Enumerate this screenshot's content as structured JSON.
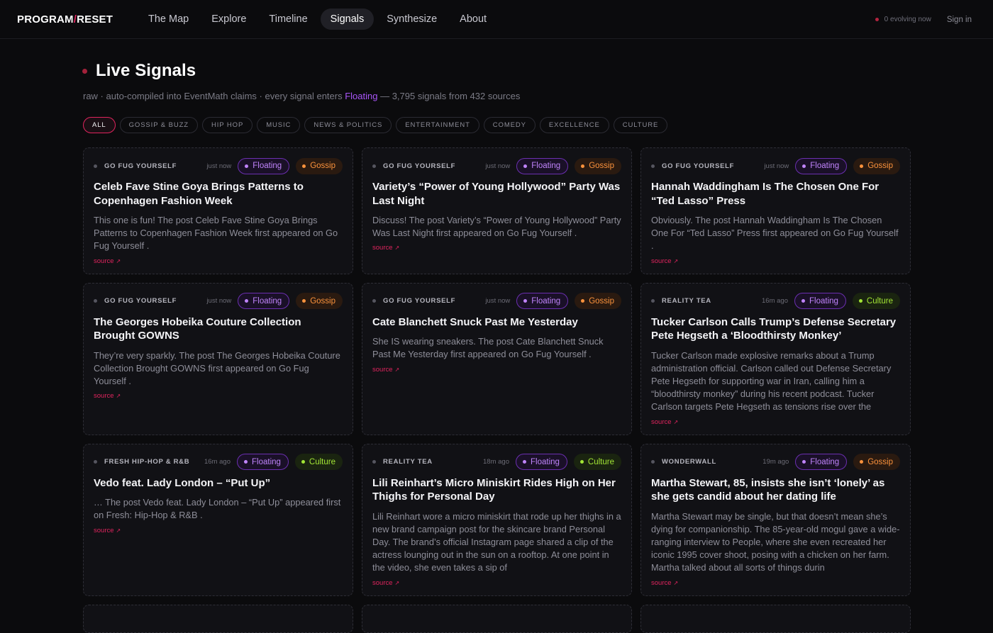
{
  "app": {
    "logo_left": "PROGRAM",
    "logo_slash": "/",
    "logo_right": "RESET"
  },
  "nav": [
    {
      "label": "The Map",
      "active": false
    },
    {
      "label": "Explore",
      "active": false
    },
    {
      "label": "Timeline",
      "active": false
    },
    {
      "label": "Signals",
      "active": true
    },
    {
      "label": "Synthesize",
      "active": false
    },
    {
      "label": "About",
      "active": false
    }
  ],
  "header": {
    "evolving": "0 evolving now",
    "signin": "Sign in"
  },
  "page": {
    "title": "Live Signals",
    "sub_pre": "raw · auto-compiled into EventMath claims · every signal enters ",
    "sub_hl": "Floating",
    "sub_post": " — 3,795 signals from 432 sources"
  },
  "filters": [
    "ALL",
    "GOSSIP & BUZZ",
    "HIP HOP",
    "MUSIC",
    "NEWS & POLITICS",
    "ENTERTAINMENT",
    "COMEDY",
    "EXCELLENCE",
    "CULTURE"
  ],
  "colors": {
    "accent": "#e0245e",
    "floating": "#c084fc",
    "gossip": "#fb923c",
    "culture": "#a3e635"
  },
  "cards": [
    {
      "source": "GO FUG YOURSELF",
      "time": "just now",
      "status": "Floating",
      "category": "Gossip",
      "title": "Celeb Fave Stine Goya Brings Patterns to Copenhagen Fashion Week",
      "desc": "This one is fun! The post Celeb Fave Stine Goya Brings Patterns to Copenhagen Fashion Week first appeared on Go Fug Yourself .",
      "link": "source"
    },
    {
      "source": "GO FUG YOURSELF",
      "time": "just now",
      "status": "Floating",
      "category": "Gossip",
      "title": "Variety’s “Power of Young Hollywood” Party Was Last Night",
      "desc": "Discuss! The post Variety’s “Power of Young Hollywood” Party Was Last Night first appeared on Go Fug Yourself .",
      "link": "source"
    },
    {
      "source": "GO FUG YOURSELF",
      "time": "just now",
      "status": "Floating",
      "category": "Gossip",
      "title": "Hannah Waddingham Is The Chosen One For “Ted Lasso” Press",
      "desc": "Obviously. The post Hannah Waddingham Is The Chosen One For “Ted Lasso” Press first appeared on Go Fug Yourself .",
      "link": "source"
    },
    {
      "source": "GO FUG YOURSELF",
      "time": "just now",
      "status": "Floating",
      "category": "Gossip",
      "title": "The Georges Hobeika Couture Collection Brought GOWNS",
      "desc": "They’re very sparkly. The post The Georges Hobeika Couture Collection Brought GOWNS first appeared on Go Fug Yourself .",
      "link": "source"
    },
    {
      "source": "GO FUG YOURSELF",
      "time": "just now",
      "status": "Floating",
      "category": "Gossip",
      "title": "Cate Blanchett Snuck Past Me Yesterday",
      "desc": "She IS wearing sneakers. The post Cate Blanchett Snuck Past Me Yesterday first appeared on Go Fug Yourself .",
      "link": "source"
    },
    {
      "source": "REALITY TEA",
      "time": "16m ago",
      "status": "Floating",
      "category": "Culture",
      "title": "Tucker Carlson Calls Trump’s Defense Secretary Pete Hegseth a ‘Bloodthirsty Monkey’",
      "desc": "Tucker Carlson made explosive remarks about a Trump administration official. Carlson called out Defense Secretary Pete Hegseth for supporting war in Iran, calling him a “bloodthirsty monkey” during his recent podcast. Tucker Carlson targets Pete Hegseth as tensions rise over the",
      "link": "source"
    },
    {
      "source": "FRESH HIP-HOP & R&B",
      "time": "16m ago",
      "status": "Floating",
      "category": "Culture",
      "title": "Vedo feat. Lady London – “Put Up”",
      "desc": "… The post Vedo feat. Lady London – “Put Up” appeared first on Fresh: Hip-Hop & R&B .",
      "link": "source"
    },
    {
      "source": "REALITY TEA",
      "time": "18m ago",
      "status": "Floating",
      "category": "Culture",
      "title": "Lili Reinhart’s Micro Miniskirt Rides High on Her Thighs for Personal Day",
      "desc": "Lili Reinhart wore a micro miniskirt that rode up her thighs in a new brand campaign post for the skincare brand Personal Day. The brand’s official Instagram page shared a clip of the actress lounging out in the sun on a rooftop. At one point in the video, she even takes a sip of",
      "link": "source"
    },
    {
      "source": "WONDERWALL",
      "time": "19m ago",
      "status": "Floating",
      "category": "Gossip",
      "title": "Martha Stewart, 85, insists she isn’t ‘lonely’ as she gets candid about her dating life",
      "desc": "Martha Stewart may be single, but that doesn’t mean she’s dying for companionship. The 85-year-old mogul gave a wide-ranging interview to People, where she even recreated her iconic 1995 cover shoot, posing with a chicken on her farm. Martha talked about all sorts of things durin",
      "link": "source"
    }
  ]
}
